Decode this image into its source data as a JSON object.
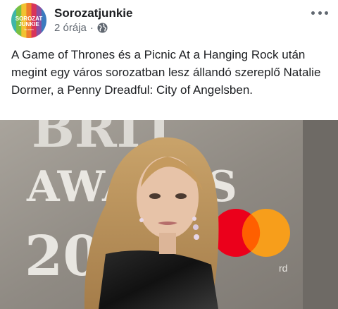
{
  "post": {
    "author": "Sorozatjunkie",
    "time": "2 órája",
    "separator": "·",
    "privacy_icon": "globe-icon",
    "more_icon": "more-options-icon",
    "text": "A Game of Thrones és a Picnic At a Hanging Rock után megint egy város sorozatban lesz állandó szereplő Natalie Dormer, a Penny Dreadful: City of Angelsben."
  },
  "avatar": {
    "line1": "SOROZAT",
    "line2": "JUNKIE",
    "line3": "hu.com",
    "stripe_colors": [
      "#3fb6a8",
      "#7ac043",
      "#f2c230",
      "#ef7d2d",
      "#d9345a",
      "#8b4fa0",
      "#3b7bbf"
    ]
  },
  "photo": {
    "backdrop_text": [
      "BRIT",
      "AWARDS",
      "20"
    ],
    "backdrop_suffix": "rd",
    "card_colors": {
      "red": "#eb001b",
      "yellow": "#f79e1b",
      "overlap": "#ff5f00"
    }
  }
}
